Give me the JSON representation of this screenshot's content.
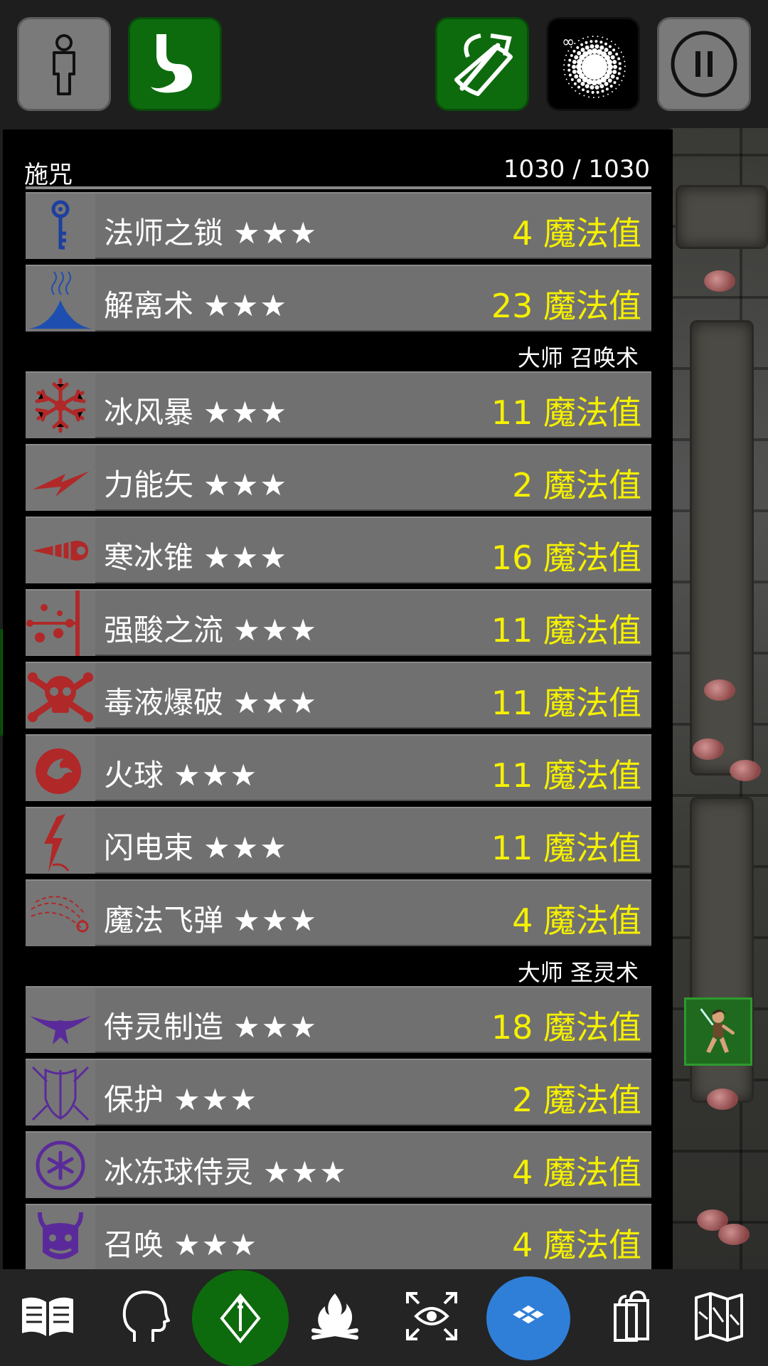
{
  "top_bar": {
    "buttons": [
      {
        "icon": "person-icon",
        "style": "gray"
      },
      {
        "icon": "stomach-icon",
        "style": "green"
      },
      {
        "icon": "bow-arrows-icon",
        "style": "green"
      },
      {
        "icon": "magic-burst-icon",
        "style": "black",
        "badge": "∞"
      },
      {
        "icon": "pause-icon",
        "style": "gray"
      }
    ]
  },
  "panel": {
    "title": "施咒",
    "mana": "1030 / 1030"
  },
  "spells": [
    {
      "name": "法师之锁",
      "stars": "★★★",
      "cost": "4 魔法值",
      "icon": "key-icon",
      "color": "#1e3fa0"
    },
    {
      "name": "解离术",
      "stars": "★★★",
      "cost": "23 魔法值",
      "icon": "dissolve-icon",
      "color": "#1e4fb0"
    },
    {
      "name": "冰风暴",
      "stars": "★★★",
      "cost": "11 魔法值",
      "icon": "snowflake-icon",
      "color": "#b02828"
    },
    {
      "name": "力能矢",
      "stars": "★★★",
      "cost": "2 魔法值",
      "icon": "force-bolt-icon",
      "color": "#b02828"
    },
    {
      "name": "寒冰锥",
      "stars": "★★★",
      "cost": "16 魔法值",
      "icon": "cone-icon",
      "color": "#b02828"
    },
    {
      "name": "强酸之流",
      "stars": "★★★",
      "cost": "11 魔法值",
      "icon": "acid-stream-icon",
      "color": "#b02828"
    },
    {
      "name": "毒液爆破",
      "stars": "★★★",
      "cost": "11 魔法值",
      "icon": "skull-crossbones-icon",
      "color": "#b02828"
    },
    {
      "name": "火球",
      "stars": "★★★",
      "cost": "11 魔法值",
      "icon": "fireball-icon",
      "color": "#b02828"
    },
    {
      "name": "闪电束",
      "stars": "★★★",
      "cost": "11 魔法值",
      "icon": "lightning-icon",
      "color": "#b02828"
    },
    {
      "name": "魔法飞弹",
      "stars": "★★★",
      "cost": "4 魔法值",
      "icon": "magic-missile-icon",
      "color": "#b02828"
    },
    {
      "name": "侍灵制造",
      "stars": "★★★",
      "cost": "18 魔法值",
      "icon": "bird-icon",
      "color": "#5a2a9a"
    },
    {
      "name": "保护",
      "stars": "★★★",
      "cost": "2 魔法值",
      "icon": "shield-icon",
      "color": "#5a2a9a"
    },
    {
      "name": "冰冻球侍灵",
      "stars": "★★★",
      "cost": "4 魔法值",
      "icon": "frost-orb-icon",
      "color": "#5a2a9a"
    },
    {
      "name": "召唤",
      "stars": "★★★",
      "cost": "4 魔法值",
      "icon": "demon-icon",
      "color": "#5a2a9a"
    }
  ],
  "schools": [
    {
      "label": "大师 召唤术"
    },
    {
      "label": "大师 圣灵术"
    }
  ],
  "bottom_bar": {
    "buttons": [
      {
        "icon": "book-icon"
      },
      {
        "icon": "head-icon"
      },
      {
        "icon": "wand-icon",
        "active": true
      },
      {
        "icon": "campfire-icon"
      },
      {
        "icon": "eye-expand-icon"
      },
      {
        "icon": "tiles-icon",
        "active": true
      },
      {
        "icon": "inventory-icon"
      },
      {
        "icon": "map-icon"
      }
    ]
  }
}
